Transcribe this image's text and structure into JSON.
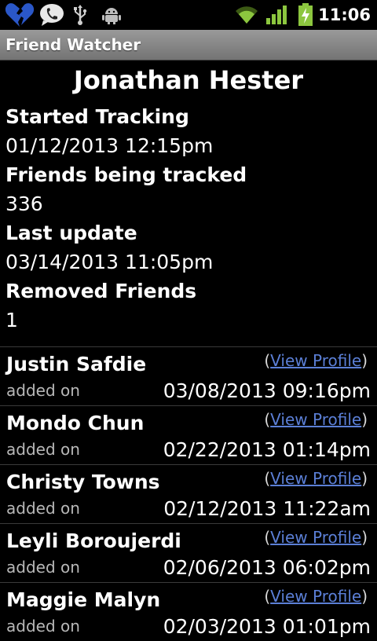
{
  "status_bar": {
    "time": "11:06",
    "icons": [
      "broken-heart-icon",
      "voicemail-call-icon",
      "usb-icon",
      "android-debug-icon",
      "wifi-icon",
      "signal-icon",
      "battery-charging-icon"
    ]
  },
  "app": {
    "title": "Friend Watcher"
  },
  "profile": {
    "name": "Jonathan Hester",
    "started_label": "Started Tracking",
    "started_value": "01/12/2013 12:15pm",
    "tracked_label": "Friends being tracked",
    "tracked_value": "336",
    "last_update_label": "Last update",
    "last_update_value": "03/14/2013 11:05pm",
    "removed_label": "Removed Friends",
    "removed_value": "1"
  },
  "list": {
    "added_label": "added on",
    "open_paren": "(",
    "close_paren": ")",
    "view_profile_label": "View Profile",
    "items": [
      {
        "name": "Justin Safdie",
        "date": "03/08/2013 09:16pm"
      },
      {
        "name": "Mondo Chun",
        "date": "02/22/2013 01:14pm"
      },
      {
        "name": "Christy Towns",
        "date": "02/12/2013 11:22am"
      },
      {
        "name": "Leyli Boroujerdi",
        "date": "02/06/2013 06:02pm"
      },
      {
        "name": "Maggie Malyn",
        "date": "02/03/2013 01:01pm"
      }
    ]
  },
  "colors": {
    "background": "#000000",
    "title_bar": "#8a8a8a",
    "link": "#5b7fd6",
    "status_green": "#8cc63f"
  }
}
